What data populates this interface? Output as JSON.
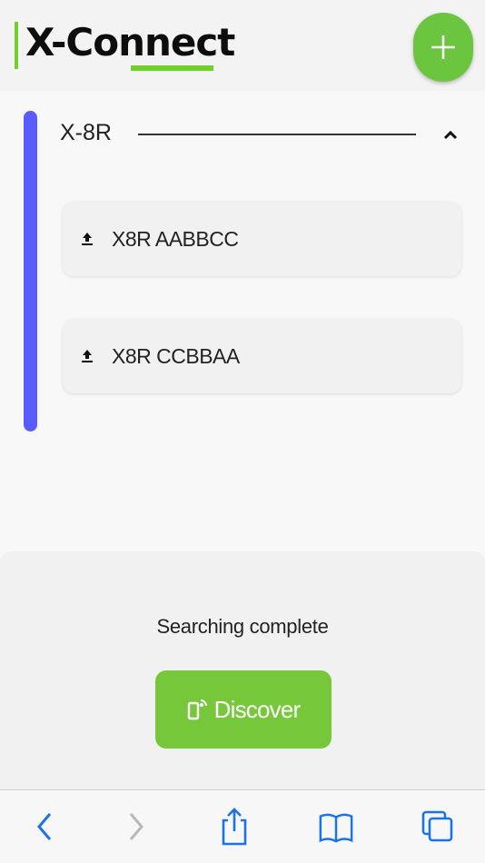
{
  "header": {
    "logo_text": "X-Connect",
    "add_icon": "plus-icon",
    "accent": "#6cc53f"
  },
  "group": {
    "title": "X-8R",
    "expanded": true,
    "accent": "#5a5cff",
    "devices": [
      {
        "label": "X8R AABBCC",
        "icon": "upload-icon"
      },
      {
        "label": "X8R CCBBAA",
        "icon": "upload-icon"
      }
    ]
  },
  "scan": {
    "status": "Searching complete",
    "discover_label": "Discover",
    "discover_icon": "device-signal-icon"
  },
  "browser_toolbar": {
    "items": [
      "back-icon",
      "forward-icon",
      "share-icon",
      "bookmarks-icon",
      "tabs-icon"
    ],
    "tint": "#1a73e8"
  }
}
